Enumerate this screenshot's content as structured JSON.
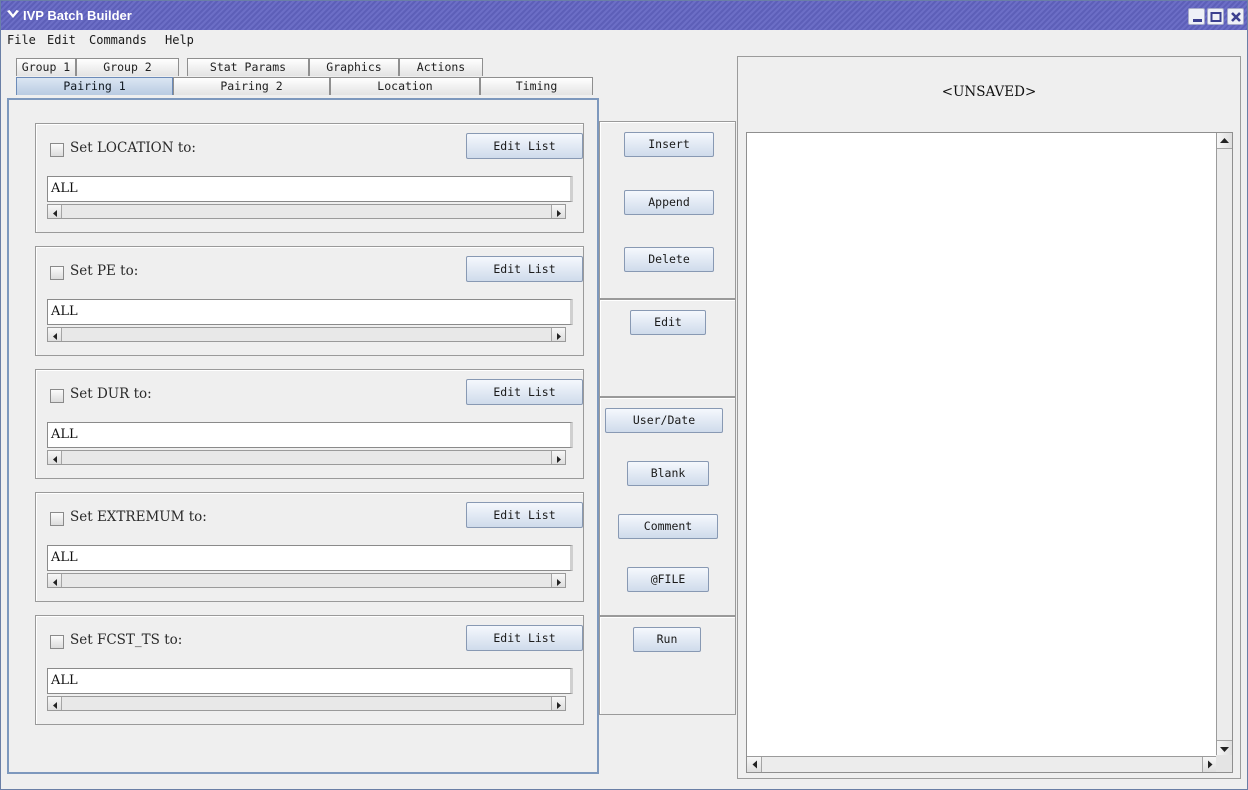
{
  "window": {
    "title": "IVP Batch Builder",
    "colors": {
      "titlebar": "#5d5fb8",
      "tab_selected": "#c6d6ea",
      "button": "#dce6f3",
      "panel_border": "#7d98bd"
    }
  },
  "menu": {
    "items": [
      {
        "label": "File"
      },
      {
        "label": "Edit"
      },
      {
        "label": "Commands"
      },
      {
        "label": "Help"
      }
    ]
  },
  "tabs_top": [
    {
      "label": "Group 1"
    },
    {
      "label": "Group 2"
    },
    {
      "label": "Stat Params"
    },
    {
      "label": "Graphics"
    },
    {
      "label": "Actions"
    }
  ],
  "tabs_bottom": [
    {
      "label": "Pairing 1",
      "selected": true
    },
    {
      "label": "Pairing 2",
      "selected": false
    },
    {
      "label": "Location",
      "selected": false
    },
    {
      "label": "Timing",
      "selected": false
    }
  ],
  "params": [
    {
      "label": "Set LOCATION to:",
      "value": "ALL",
      "button": "Edit List",
      "checked": false
    },
    {
      "label": "Set PE to:",
      "value": "ALL",
      "button": "Edit List",
      "checked": false
    },
    {
      "label": "Set DUR to:",
      "value": "ALL",
      "button": "Edit List",
      "checked": false
    },
    {
      "label": "Set EXTREMUM to:",
      "value": "ALL",
      "button": "Edit List",
      "checked": false
    },
    {
      "label": "Set FCST_TS to:",
      "value": "ALL",
      "button": "Edit List",
      "checked": false
    }
  ],
  "actions": {
    "insert": "Insert",
    "append": "Append",
    "delete": "Delete",
    "edit": "Edit",
    "user_date": "User/Date",
    "blank": "Blank",
    "comment": "Comment",
    "file": "@FILE",
    "run": "Run"
  },
  "editor": {
    "status": "<UNSAVED>",
    "content": ""
  }
}
